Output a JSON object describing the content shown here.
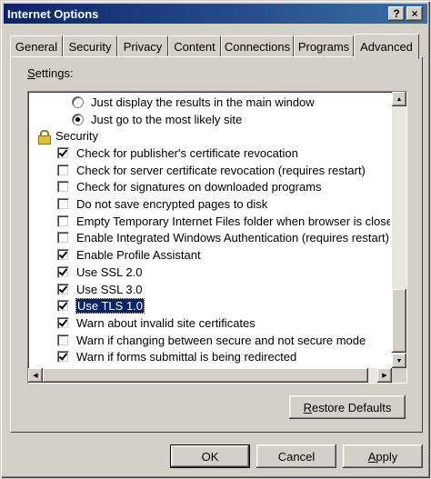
{
  "window": {
    "title": "Internet Options",
    "help_label": "?",
    "close_label": "×"
  },
  "tabs": [
    {
      "label": "General"
    },
    {
      "label": "Security"
    },
    {
      "label": "Privacy"
    },
    {
      "label": "Content"
    },
    {
      "label": "Connections"
    },
    {
      "label": "Programs"
    },
    {
      "label": "Advanced"
    }
  ],
  "active_tab": "Advanced",
  "settings": {
    "label_prefix": "S",
    "label_rest": "ettings:",
    "rows": [
      {
        "type": "radio",
        "checked": false,
        "label": "Just display the results in the main window"
      },
      {
        "type": "radio",
        "checked": true,
        "label": "Just go to the most likely site"
      },
      {
        "type": "category",
        "icon": "lock-icon",
        "label": "Security"
      },
      {
        "type": "checkbox",
        "checked": true,
        "label": "Check for publisher's certificate revocation"
      },
      {
        "type": "checkbox",
        "checked": false,
        "label": "Check for server certificate revocation (requires restart)"
      },
      {
        "type": "checkbox",
        "checked": false,
        "label": "Check for signatures on downloaded programs"
      },
      {
        "type": "checkbox",
        "checked": false,
        "label": "Do not save encrypted pages to disk"
      },
      {
        "type": "checkbox",
        "checked": false,
        "label": "Empty Temporary Internet Files folder when browser is closed"
      },
      {
        "type": "checkbox",
        "checked": false,
        "label": "Enable Integrated Windows Authentication (requires restart)"
      },
      {
        "type": "checkbox",
        "checked": true,
        "label": "Enable Profile Assistant"
      },
      {
        "type": "checkbox",
        "checked": true,
        "label": "Use SSL 2.0"
      },
      {
        "type": "checkbox",
        "checked": true,
        "label": "Use SSL 3.0"
      },
      {
        "type": "checkbox",
        "checked": true,
        "label": "Use TLS 1.0",
        "selected": true
      },
      {
        "type": "checkbox",
        "checked": true,
        "label": "Warn about invalid site certificates"
      },
      {
        "type": "checkbox",
        "checked": false,
        "label": "Warn if changing between secure and not secure mode"
      },
      {
        "type": "checkbox",
        "checked": true,
        "label": "Warn if forms submittal is being redirected"
      }
    ]
  },
  "buttons": {
    "restore_prefix": "R",
    "restore_rest": "estore Defaults",
    "ok": "OK",
    "cancel": "Cancel",
    "apply_prefix": "A",
    "apply_rest": "pply"
  }
}
